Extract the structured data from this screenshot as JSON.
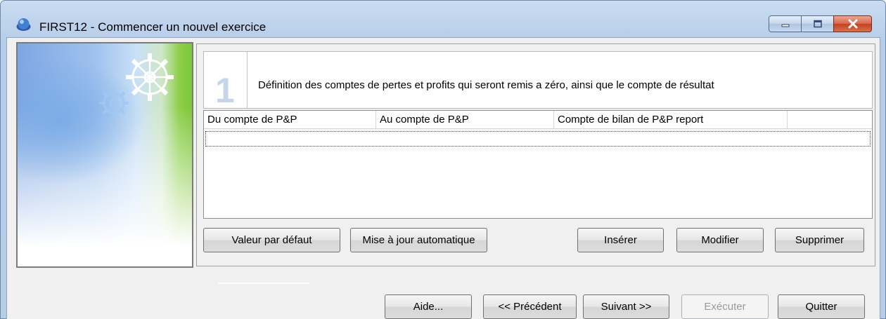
{
  "window": {
    "title": "FIRST12 - Commencer un nouvel exercice"
  },
  "step": {
    "number": "1",
    "description": "Définition des comptes de pertes et profits qui seront remis a zéro, ainsi que le compte de résultat"
  },
  "grid": {
    "columns": [
      "Du compte de P&P",
      "Au compte de P&P",
      "Compte de bilan de P&P report",
      ""
    ],
    "rows": []
  },
  "grid_buttons": {
    "default_value": "Valeur par défaut",
    "auto_update": "Mise à jour automatique",
    "insert": "Insérer",
    "modify": "Modifier",
    "delete": "Supprimer"
  },
  "nav_buttons": {
    "help": "Aide...",
    "previous": "<< Précédent",
    "next": "Suivant >>",
    "execute": "Exécuter",
    "quit": "Quitter"
  },
  "icons": {
    "app": "app-icon",
    "minimize": "minimize-icon",
    "maximize": "maximize-icon",
    "close": "close-icon",
    "gear": "gear-icon"
  },
  "colors": {
    "title_bar": "#c9dcf0",
    "close_button": "#c4421f",
    "step_number": "#c6d5ea",
    "banner_green": "#7dc63a"
  }
}
